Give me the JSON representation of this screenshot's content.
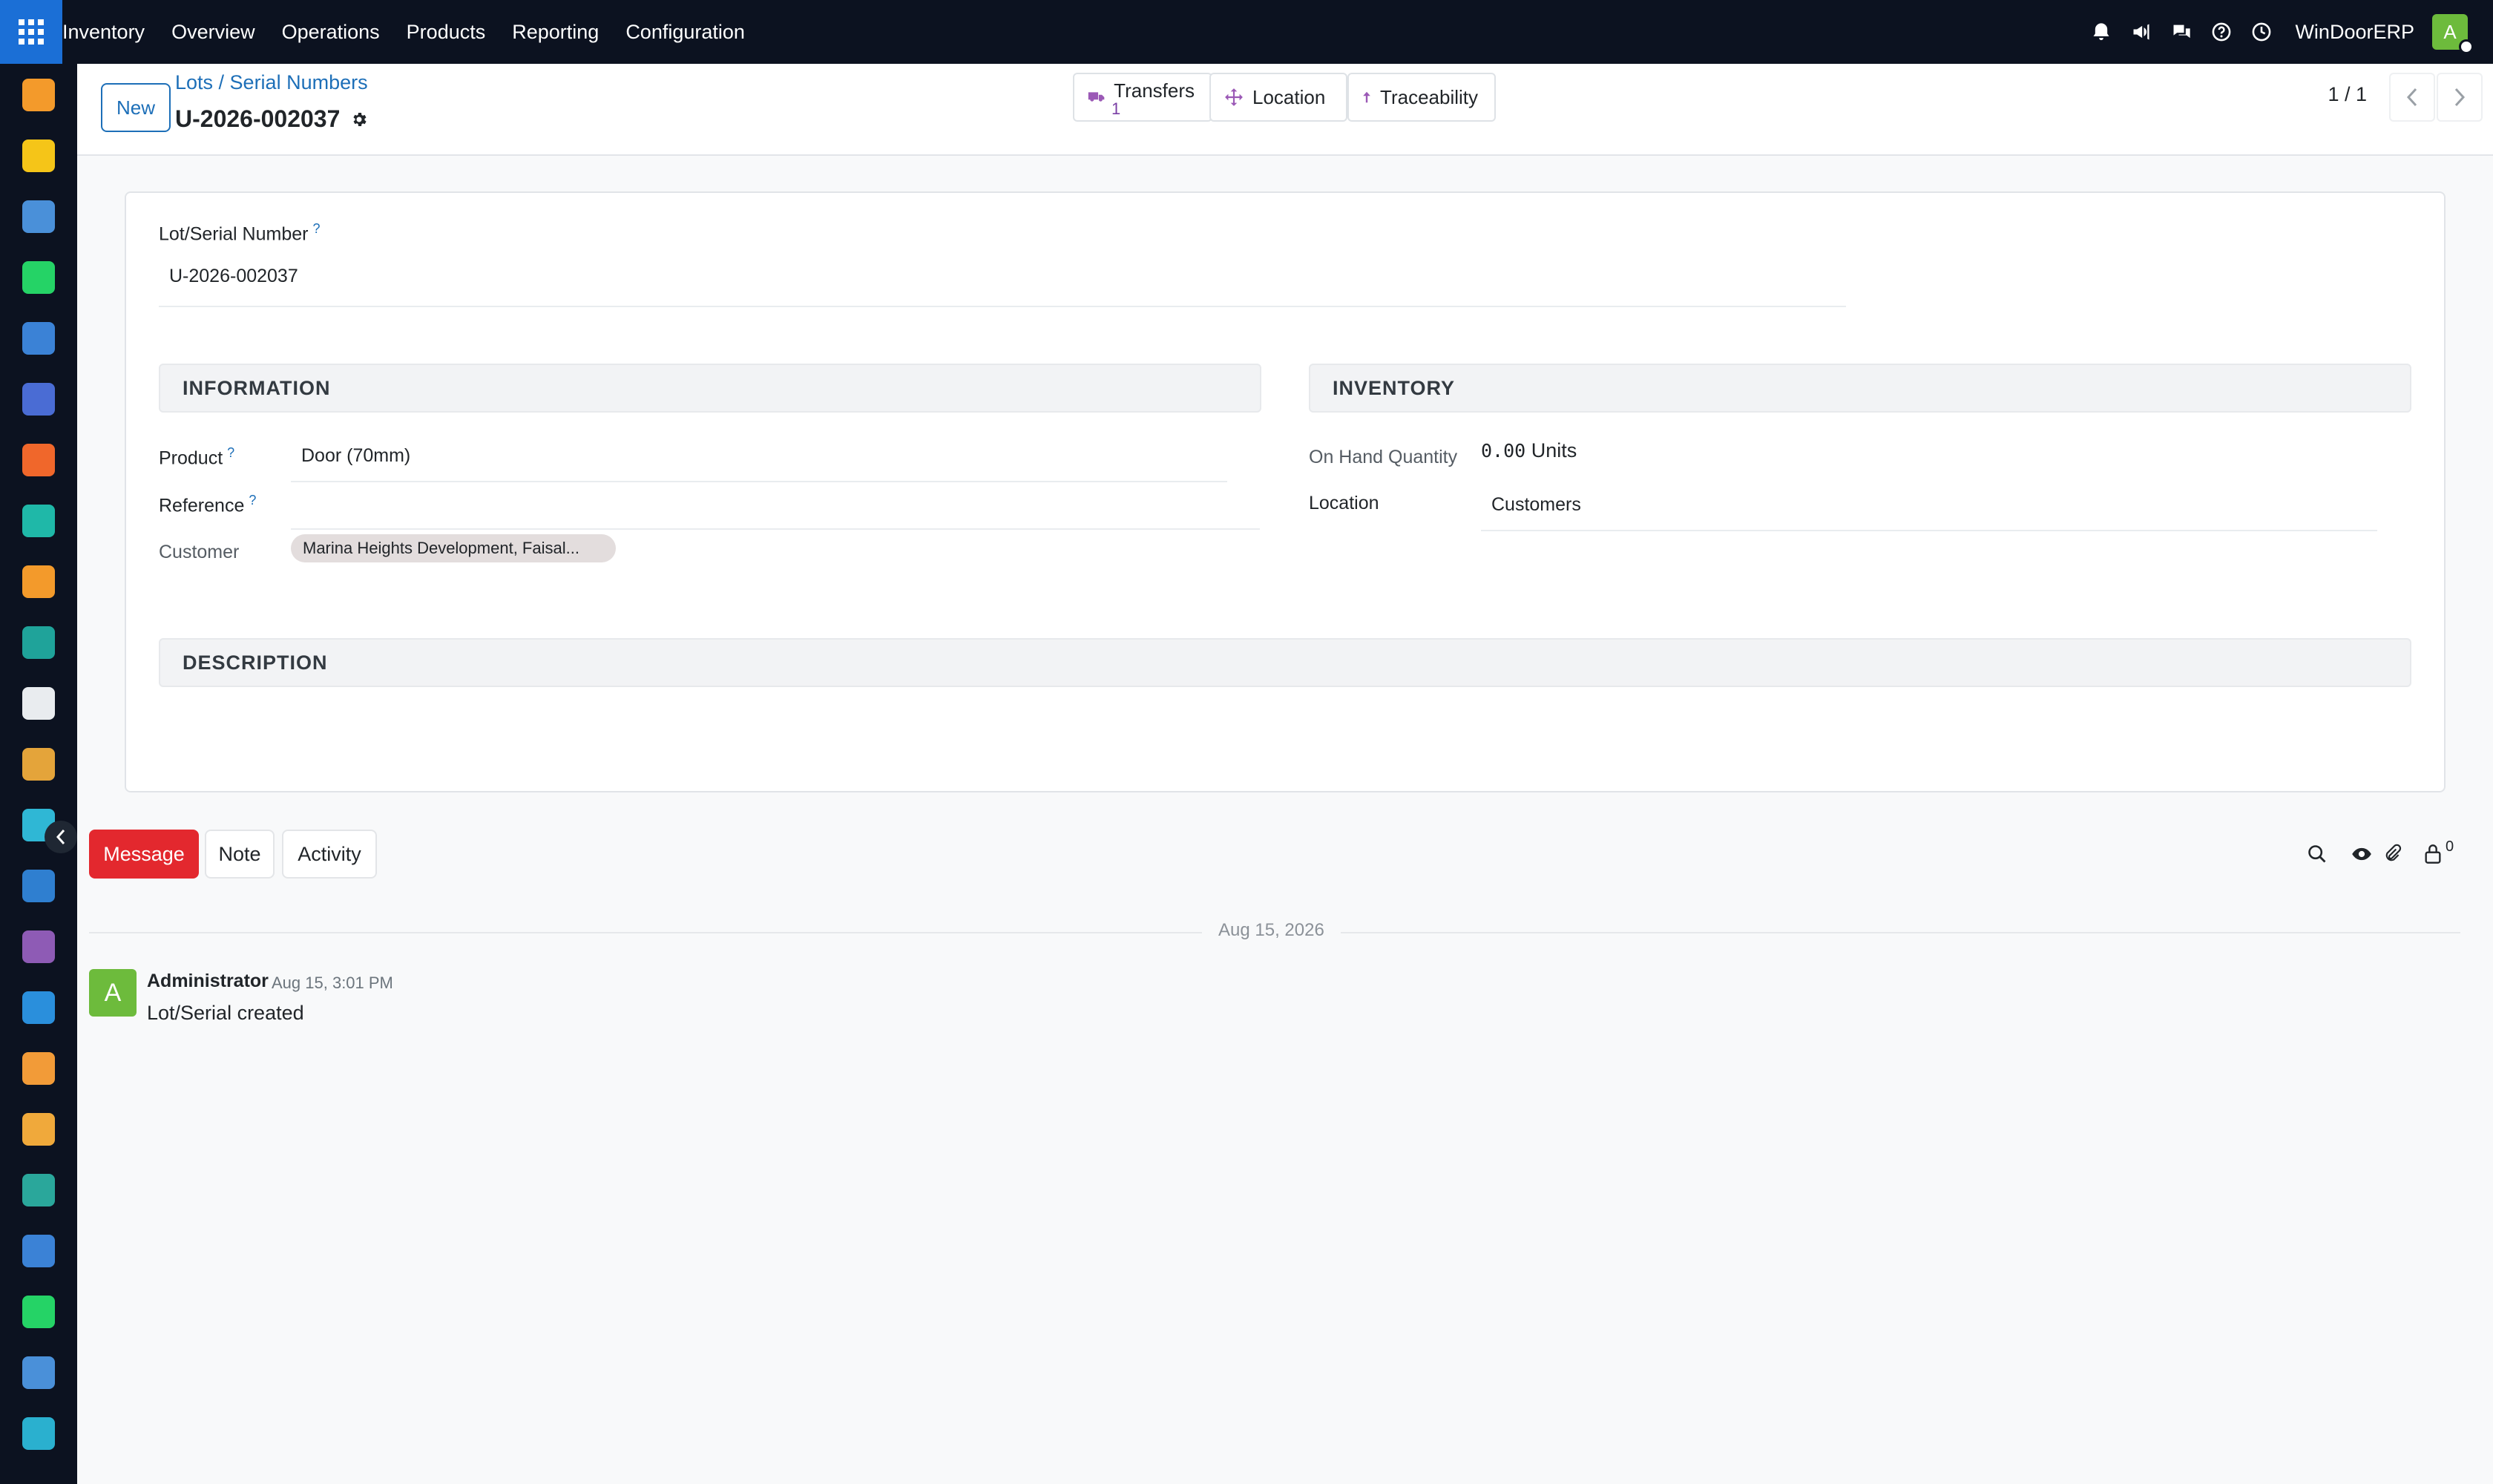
{
  "navbar": {
    "menu": [
      "Inventory",
      "Overview",
      "Operations",
      "Products",
      "Reporting",
      "Configuration"
    ],
    "company": "WinDoorERP",
    "user_initial": "A",
    "icons": [
      "bell-icon",
      "megaphone-icon",
      "chat-bubbles-icon",
      "help-icon",
      "clock-icon"
    ]
  },
  "rail": {
    "apps": [
      {
        "name": "app-icon-bar-chart",
        "color": "#f39a2b"
      },
      {
        "name": "app-icon-paper-plane",
        "color": "#f5c518"
      },
      {
        "name": "app-icon-gauge",
        "color": "#4a90d9"
      },
      {
        "name": "app-icon-whatsapp",
        "color": "#25d366"
      },
      {
        "name": "app-icon-dashboard",
        "color": "#3b82d6"
      },
      {
        "name": "app-icon-mail",
        "color": "#4a6cd4"
      },
      {
        "name": "app-icon-chat-bubble",
        "color": "#f0672b"
      },
      {
        "name": "app-icon-chevron-check",
        "color": "#1fb8a8"
      },
      {
        "name": "app-icon-reporting",
        "color": "#f39a2b"
      },
      {
        "name": "app-icon-contacts",
        "color": "#1fa39a"
      },
      {
        "name": "app-icon-box",
        "color": "#e9ecef"
      },
      {
        "name": "app-icon-brush",
        "color": "#e4a43a"
      },
      {
        "name": "app-icon-checkmark",
        "color": "#2fb7d5"
      },
      {
        "name": "app-icon-book",
        "color": "#2f7fd0"
      },
      {
        "name": "app-icon-cube",
        "color": "#8e5bb5"
      },
      {
        "name": "app-icon-invoice",
        "color": "#2a8fdc"
      },
      {
        "name": "app-icon-employees",
        "color": "#f29b38"
      },
      {
        "name": "app-icon-calendar",
        "color": "#f0a93b"
      },
      {
        "name": "app-icon-sign",
        "color": "#2aa79b"
      },
      {
        "name": "app-icon-dashboard-2",
        "color": "#3b82d6"
      },
      {
        "name": "app-icon-whatsapp-2",
        "color": "#25d366"
      },
      {
        "name": "app-icon-gauge-2",
        "color": "#4a90d9"
      },
      {
        "name": "app-icon-waves",
        "color": "#2ab0cf"
      }
    ]
  },
  "control_panel": {
    "new_label": "New",
    "breadcrumb": "Lots / Serial Numbers",
    "record_title": "U-2026-002037",
    "smart_buttons": {
      "transfers_label": "Transfers",
      "transfers_count": "1",
      "location_label": "Location",
      "traceability_label": "Traceability"
    },
    "pager": "1 / 1"
  },
  "form": {
    "lot_label": "Lot/Serial Number",
    "help_mark": "?",
    "lot_value": "U-2026-002037",
    "information": {
      "title": "INFORMATION",
      "product_label": "Product",
      "product_value": "Door (70mm)",
      "reference_label": "Reference",
      "reference_value": "",
      "customer_label": "Customer",
      "customer_tag": "Marina Heights Development, Faisal..."
    },
    "inventory": {
      "title": "INVENTORY",
      "on_hand_label": "On Hand Quantity",
      "on_hand_value": "0.00",
      "on_hand_unit": "Units",
      "location_label": "Location",
      "location_value": "Customers"
    },
    "description_title": "DESCRIPTION"
  },
  "chatter": {
    "message_label": "Message",
    "note_label": "Note",
    "activity_label": "Activity",
    "follower_count": "0",
    "date_separator": "Aug 15, 2026",
    "messages": [
      {
        "avatar": "A",
        "author": "Administrator",
        "time": "Aug 15, 3:01 PM",
        "body": "Lot/Serial created"
      }
    ]
  }
}
